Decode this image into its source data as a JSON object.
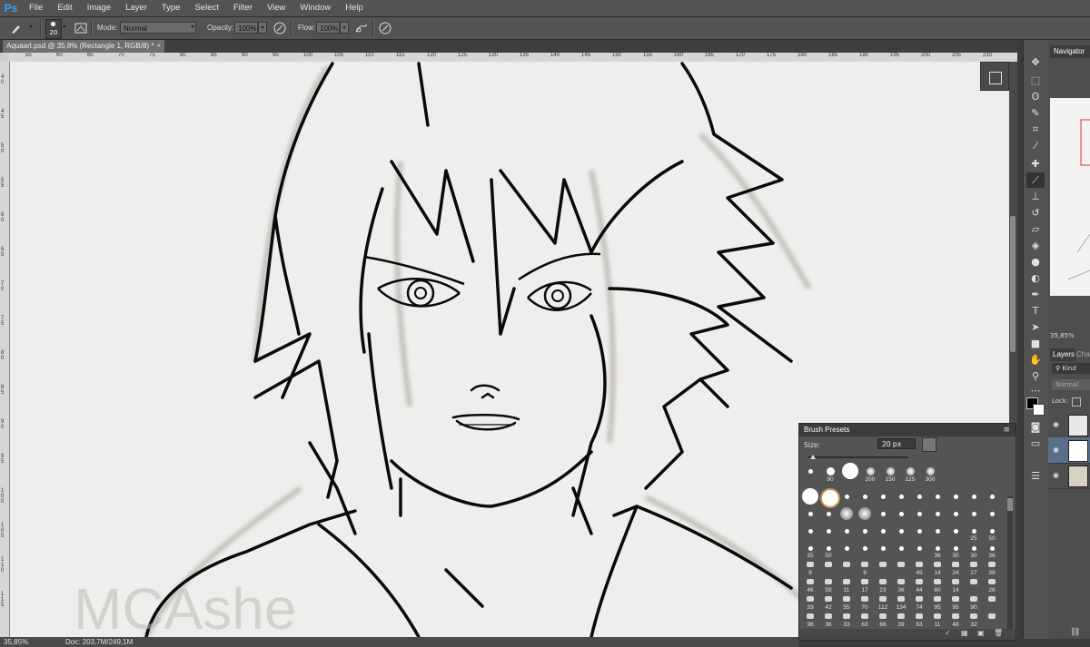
{
  "app": {
    "logo": "Ps"
  },
  "menu": [
    "File",
    "Edit",
    "Image",
    "Layer",
    "Type",
    "Select",
    "Filter",
    "View",
    "Window",
    "Help"
  ],
  "options": {
    "brush_size": "20",
    "mode_label": "Mode:",
    "mode_value": "Normal",
    "opacity_label": "Opacity:",
    "opacity_value": "100%",
    "flow_label": "Flow:",
    "flow_value": "100%"
  },
  "document": {
    "tab_title": "Aquaart.psd @ 35,8% (Rectangle 1, RGB/8) *",
    "tab_close": "×",
    "zoom": "35,85%",
    "doc_size": "Doc: 203,7M/249,1M",
    "watermark": "MCAshe"
  },
  "ruler": {
    "top_ticks": [
      "55",
      "60",
      "65",
      "70",
      "75",
      "80",
      "85",
      "90",
      "95",
      "100",
      "105",
      "110",
      "115",
      "120",
      "125",
      "130",
      "135",
      "140",
      "145",
      "150",
      "155",
      "160",
      "165",
      "170",
      "175",
      "180",
      "185",
      "190",
      "195",
      "200",
      "205",
      "210"
    ],
    "left_ticks": [
      "40",
      "45",
      "50",
      "55",
      "60",
      "65",
      "70",
      "75",
      "80",
      "85",
      "90",
      "95",
      "100",
      "105",
      "110",
      "115"
    ]
  },
  "navigator": {
    "title": "Navigator",
    "zoom": "35,85%"
  },
  "layers": {
    "tab_layers": "Layers",
    "tab_channels": "Cha",
    "kind_filter": "Kind",
    "blend_mode": "Normal",
    "lock_label": "Lock:"
  },
  "brush_presets": {
    "title": "Brush Presets",
    "size_label": "Size:",
    "size_value": "20 px",
    "row1": [
      "",
      "90",
      "",
      "200",
      "150",
      "125",
      "300"
    ],
    "grid_labels": [
      [
        "",
        "",
        "",
        "",
        "",
        "",
        "",
        "",
        "",
        "",
        ""
      ],
      [
        "",
        "",
        "",
        "",
        "",
        "",
        "",
        "",
        "",
        "",
        ""
      ],
      [
        "",
        "",
        "",
        "",
        "",
        "",
        "",
        "",
        "",
        "25",
        "50"
      ],
      [
        "25",
        "50",
        "",
        "",
        "",
        "",
        "",
        "36",
        "30",
        "30",
        "36"
      ],
      [
        "9",
        "",
        "",
        "9",
        "",
        "",
        "45",
        "14",
        "24",
        "27",
        "39"
      ],
      [
        "46",
        "59",
        "11",
        "17",
        "23",
        "36",
        "44",
        "60",
        "14",
        "",
        "26"
      ],
      [
        "33",
        "42",
        "55",
        "70",
        "112",
        "134",
        "74",
        "95",
        "95",
        "90",
        ""
      ],
      [
        "36",
        "36",
        "33",
        "63",
        "66",
        "39",
        "63",
        "11",
        "48",
        "32",
        ""
      ]
    ]
  },
  "colors": {
    "accent": "#31a8ff",
    "canvas": "#efeeec",
    "ui_dark": "#535353"
  }
}
